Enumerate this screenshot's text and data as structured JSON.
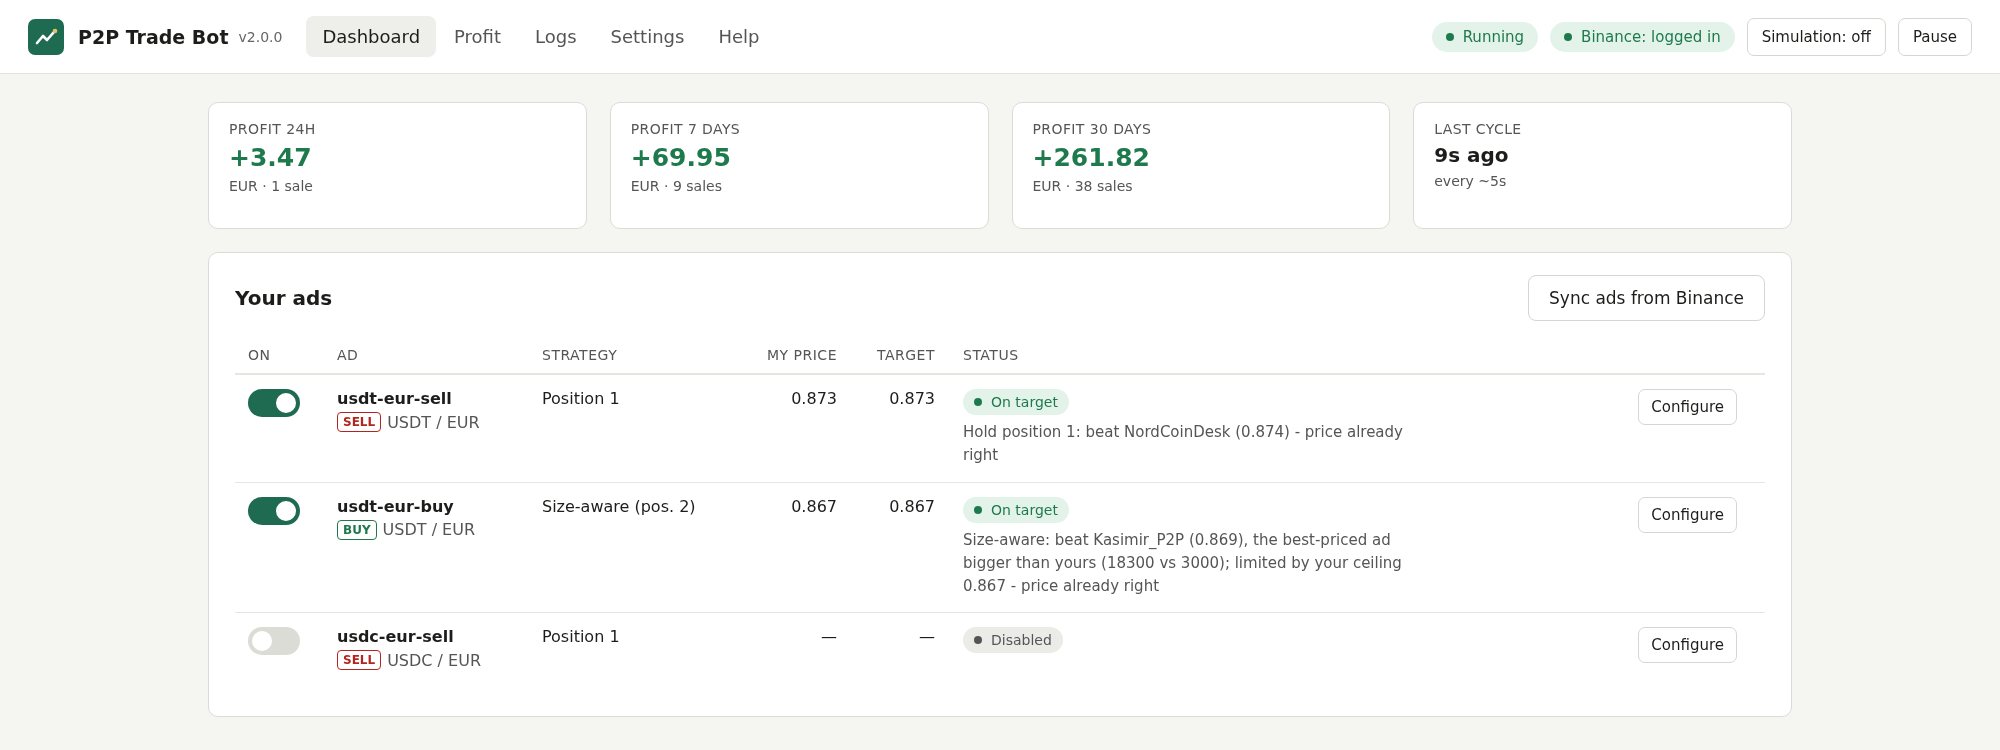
{
  "app": {
    "name": "P2P Trade Bot",
    "version": "v2.0.0"
  },
  "nav": [
    {
      "label": "Dashboard",
      "selected": true
    },
    {
      "label": "Profit",
      "selected": false
    },
    {
      "label": "Logs",
      "selected": false
    },
    {
      "label": "Settings",
      "selected": false
    },
    {
      "label": "Help",
      "selected": false
    }
  ],
  "status_pills": [
    {
      "label": "Running"
    },
    {
      "label": "Binance: logged in"
    }
  ],
  "header_buttons": [
    "Simulation: off",
    "Pause"
  ],
  "stats": [
    {
      "label": "PROFIT 24H",
      "value": "+3.47",
      "note": "EUR · 1 sale",
      "kind": "profit"
    },
    {
      "label": "PROFIT 7 DAYS",
      "value": "+69.95",
      "note": "EUR · 9 sales",
      "kind": "profit"
    },
    {
      "label": "PROFIT 30 DAYS",
      "value": "+261.82",
      "note": "EUR · 38 sales",
      "kind": "profit"
    },
    {
      "label": "LAST CYCLE",
      "value": "9s ago",
      "note": "every ~5s",
      "kind": "plain"
    }
  ],
  "ads": {
    "title": "Your ads",
    "sync_button": "Sync ads from Binance",
    "columns": [
      "ON",
      "AD",
      "STRATEGY",
      "MY PRICE",
      "TARGET",
      "STATUS"
    ],
    "rows": [
      {
        "on": true,
        "name": "usdt-eur-sell",
        "side": {
          "label": "SELL",
          "kind": "sell"
        },
        "pair": "USDT / EUR",
        "strategy": "Position 1",
        "my_price": "0.873",
        "target": "0.873",
        "status": {
          "label": "On target",
          "kind": "ok"
        },
        "detail": "Hold position 1: beat NordCoinDesk (0.874) - price already right",
        "action": "Configure"
      },
      {
        "on": true,
        "name": "usdt-eur-buy",
        "side": {
          "label": "BUY",
          "kind": "buy"
        },
        "pair": "USDT / EUR",
        "strategy": "Size-aware (pos. 2)",
        "my_price": "0.867",
        "target": "0.867",
        "status": {
          "label": "On target",
          "kind": "ok"
        },
        "detail": "Size-aware: beat Kasimir_P2P (0.869), the best-priced ad bigger than yours (18300 vs 3000); limited by your ceiling 0.867 - price already right",
        "action": "Configure"
      },
      {
        "on": false,
        "name": "usdc-eur-sell",
        "side": {
          "label": "SELL",
          "kind": "sell"
        },
        "pair": "USDC / EUR",
        "strategy": "Position 1",
        "my_price": "—",
        "target": "—",
        "status": {
          "label": "Disabled",
          "kind": "disabled"
        },
        "action": "Configure"
      }
    ]
  }
}
